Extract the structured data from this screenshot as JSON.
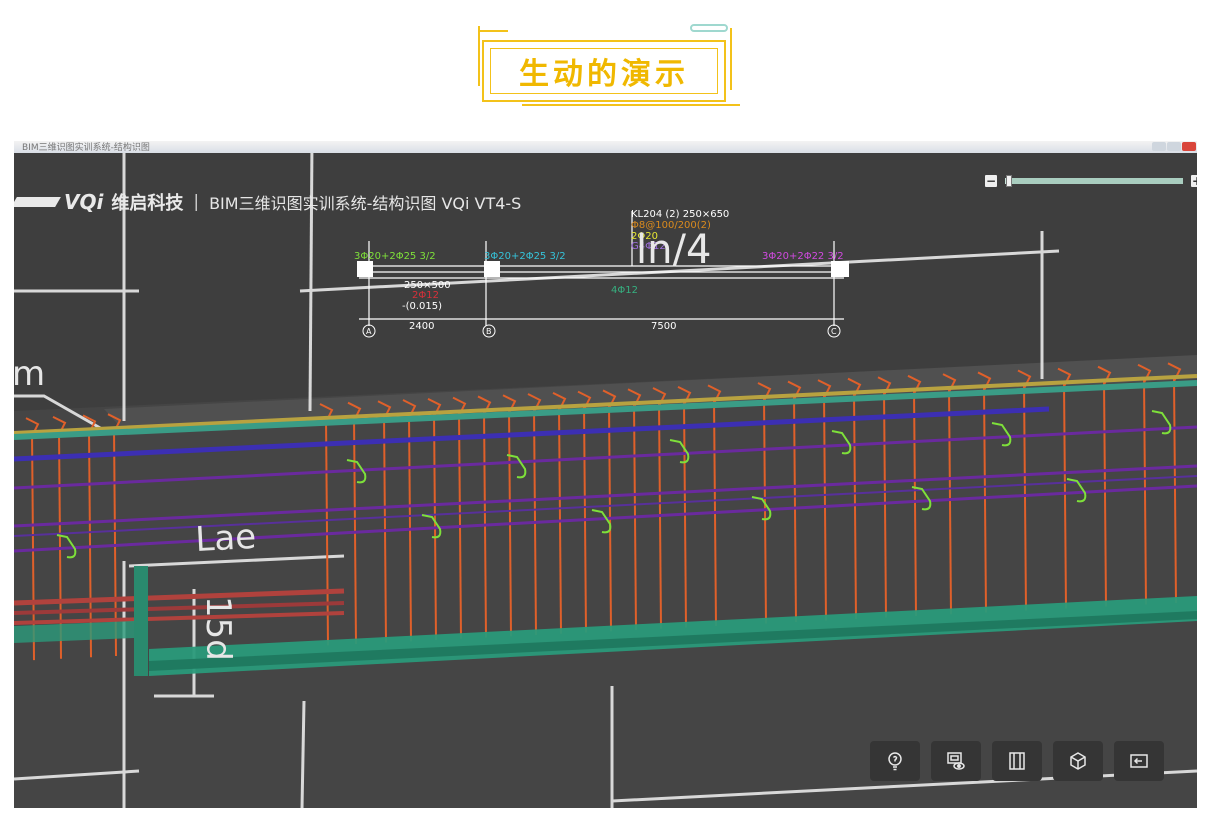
{
  "banner": {
    "title": "生动的演示"
  },
  "window": {
    "title": "BIM三维识图实训系统-结构识图"
  },
  "brand": {
    "logo": "VQi",
    "company": "维启科技",
    "separator": "|",
    "system_name": "BIM三维识图实训系统-结构识图 VQi VT4-S"
  },
  "zoom": {
    "minus": "−",
    "plus": "+",
    "level": 0.02
  },
  "drawing": {
    "beam_label": "KL204 (2)  250×650",
    "beam_stirrup": "Φ8@100/200(2)",
    "beam_top": "2Φ20",
    "beam_side": "G4Φ12",
    "big_label": "ln/4",
    "rebar_1": "3Φ20+2Φ25  3/2",
    "rebar_2": "3Φ20+2Φ25  3/2",
    "rebar_3": "3Φ20+2Φ22  3/2",
    "section": "250×500",
    "elev_red": "2Φ12",
    "elevation": "-(0.015)",
    "mid_rebar": "4Φ12",
    "axis_a": "A",
    "axis_b": "B",
    "axis_c": "C",
    "span_1": "2400",
    "span_2": "7500",
    "lae_label": "Lae",
    "d15_label": "15d",
    "m_label": "m"
  },
  "toolbar": [
    {
      "icon": "hint-bulb-icon"
    },
    {
      "icon": "view-eye-icon"
    },
    {
      "icon": "section-icon"
    },
    {
      "icon": "cube-3d-icon"
    },
    {
      "icon": "exit-icon"
    }
  ],
  "colors": {
    "background": "#3e3e3e",
    "stirrup": "#e0602a",
    "bar_blue": "#3c2fb3",
    "bar_purple": "#6a2a9e",
    "mesh_green": "#2a9a7a",
    "hook": "#7ee03a",
    "accent": "#f3c21a"
  }
}
